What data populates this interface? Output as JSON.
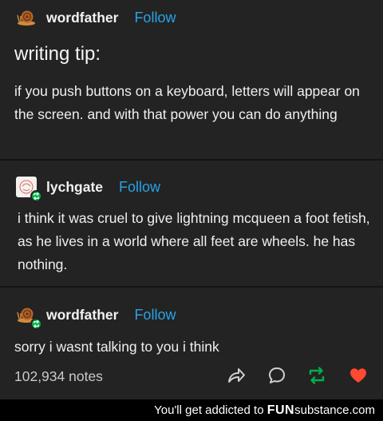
{
  "post": {
    "op": {
      "username": "wordfather",
      "follow_label": "Follow",
      "title": "writing tip:",
      "body": "if you push buttons on a keyboard, letters will appear on the screen. and with that power you can do anything"
    },
    "reply1": {
      "username": "lychgate",
      "follow_label": "Follow",
      "body": "i think it was cruel to give lightning mcqueen a foot fetish, as he lives in a world where all feet are wheels. he has nothing."
    },
    "reply2": {
      "username": "wordfather",
      "follow_label": "Follow",
      "body": "sorry i wasnt talking to you i think"
    },
    "notes": "102,934 notes",
    "actions": {
      "share": "share-icon",
      "reply": "reply-icon",
      "reblog": "reblog-icon",
      "like": "heart-icon"
    },
    "colors": {
      "background": "#232323",
      "follow": "#27a3e8",
      "reblog": "#00b04a",
      "like": "#ff4930"
    }
  },
  "footer": {
    "prefix": "You'll get addicted to ",
    "brand_bold": "FUN",
    "brand_rest": "substance.com"
  }
}
